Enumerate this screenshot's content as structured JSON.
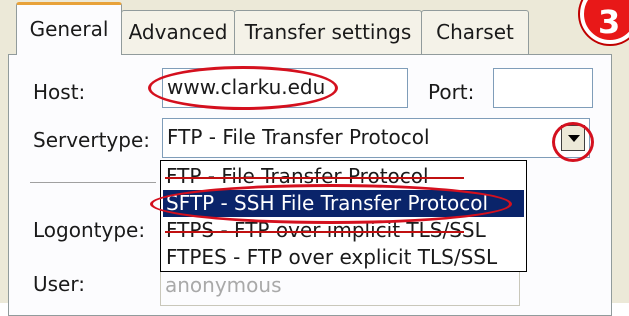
{
  "tabs": [
    "General",
    "Advanced",
    "Transfer settings",
    "Charset"
  ],
  "form": {
    "host_label": "Host:",
    "host_value": "www.clarku.edu",
    "port_label": "Port:",
    "port_value": "",
    "servertype_label": "Servertype:",
    "servertype_value": "FTP - File Transfer Protocol",
    "logontype_label": "Logontype:",
    "user_label": "User:",
    "user_value": "anonymous"
  },
  "dropdown_options": [
    "FTP - File Transfer Protocol",
    "SFTP - SSH File Transfer Protocol",
    "FTPS - FTP over implicit TLS/SSL",
    "FTPES - FTP over explicit TLS/SSL"
  ],
  "selected_option": "SFTP - SSH File Transfer Protocol",
  "step_badge": "3",
  "colors": {
    "annotation": "#d4101e",
    "selection": "#0a246a",
    "tab_highlight": "#e8a23a"
  }
}
